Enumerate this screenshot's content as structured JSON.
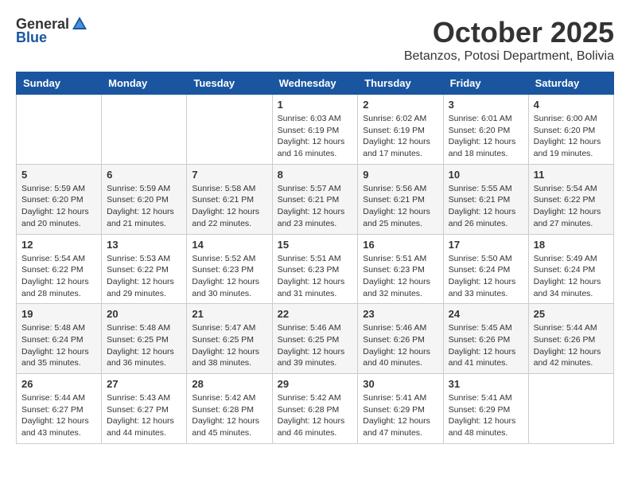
{
  "header": {
    "logo_general": "General",
    "logo_blue": "Blue",
    "month_title": "October 2025",
    "location": "Betanzos, Potosi Department, Bolivia"
  },
  "days_of_week": [
    "Sunday",
    "Monday",
    "Tuesday",
    "Wednesday",
    "Thursday",
    "Friday",
    "Saturday"
  ],
  "weeks": [
    [
      {
        "day": "",
        "sunrise": "",
        "sunset": "",
        "daylight": ""
      },
      {
        "day": "",
        "sunrise": "",
        "sunset": "",
        "daylight": ""
      },
      {
        "day": "",
        "sunrise": "",
        "sunset": "",
        "daylight": ""
      },
      {
        "day": "1",
        "sunrise": "Sunrise: 6:03 AM",
        "sunset": "Sunset: 6:19 PM",
        "daylight": "Daylight: 12 hours and 16 minutes."
      },
      {
        "day": "2",
        "sunrise": "Sunrise: 6:02 AM",
        "sunset": "Sunset: 6:19 PM",
        "daylight": "Daylight: 12 hours and 17 minutes."
      },
      {
        "day": "3",
        "sunrise": "Sunrise: 6:01 AM",
        "sunset": "Sunset: 6:20 PM",
        "daylight": "Daylight: 12 hours and 18 minutes."
      },
      {
        "day": "4",
        "sunrise": "Sunrise: 6:00 AM",
        "sunset": "Sunset: 6:20 PM",
        "daylight": "Daylight: 12 hours and 19 minutes."
      }
    ],
    [
      {
        "day": "5",
        "sunrise": "Sunrise: 5:59 AM",
        "sunset": "Sunset: 6:20 PM",
        "daylight": "Daylight: 12 hours and 20 minutes."
      },
      {
        "day": "6",
        "sunrise": "Sunrise: 5:59 AM",
        "sunset": "Sunset: 6:20 PM",
        "daylight": "Daylight: 12 hours and 21 minutes."
      },
      {
        "day": "7",
        "sunrise": "Sunrise: 5:58 AM",
        "sunset": "Sunset: 6:21 PM",
        "daylight": "Daylight: 12 hours and 22 minutes."
      },
      {
        "day": "8",
        "sunrise": "Sunrise: 5:57 AM",
        "sunset": "Sunset: 6:21 PM",
        "daylight": "Daylight: 12 hours and 23 minutes."
      },
      {
        "day": "9",
        "sunrise": "Sunrise: 5:56 AM",
        "sunset": "Sunset: 6:21 PM",
        "daylight": "Daylight: 12 hours and 25 minutes."
      },
      {
        "day": "10",
        "sunrise": "Sunrise: 5:55 AM",
        "sunset": "Sunset: 6:21 PM",
        "daylight": "Daylight: 12 hours and 26 minutes."
      },
      {
        "day": "11",
        "sunrise": "Sunrise: 5:54 AM",
        "sunset": "Sunset: 6:22 PM",
        "daylight": "Daylight: 12 hours and 27 minutes."
      }
    ],
    [
      {
        "day": "12",
        "sunrise": "Sunrise: 5:54 AM",
        "sunset": "Sunset: 6:22 PM",
        "daylight": "Daylight: 12 hours and 28 minutes."
      },
      {
        "day": "13",
        "sunrise": "Sunrise: 5:53 AM",
        "sunset": "Sunset: 6:22 PM",
        "daylight": "Daylight: 12 hours and 29 minutes."
      },
      {
        "day": "14",
        "sunrise": "Sunrise: 5:52 AM",
        "sunset": "Sunset: 6:23 PM",
        "daylight": "Daylight: 12 hours and 30 minutes."
      },
      {
        "day": "15",
        "sunrise": "Sunrise: 5:51 AM",
        "sunset": "Sunset: 6:23 PM",
        "daylight": "Daylight: 12 hours and 31 minutes."
      },
      {
        "day": "16",
        "sunrise": "Sunrise: 5:51 AM",
        "sunset": "Sunset: 6:23 PM",
        "daylight": "Daylight: 12 hours and 32 minutes."
      },
      {
        "day": "17",
        "sunrise": "Sunrise: 5:50 AM",
        "sunset": "Sunset: 6:24 PM",
        "daylight": "Daylight: 12 hours and 33 minutes."
      },
      {
        "day": "18",
        "sunrise": "Sunrise: 5:49 AM",
        "sunset": "Sunset: 6:24 PM",
        "daylight": "Daylight: 12 hours and 34 minutes."
      }
    ],
    [
      {
        "day": "19",
        "sunrise": "Sunrise: 5:48 AM",
        "sunset": "Sunset: 6:24 PM",
        "daylight": "Daylight: 12 hours and 35 minutes."
      },
      {
        "day": "20",
        "sunrise": "Sunrise: 5:48 AM",
        "sunset": "Sunset: 6:25 PM",
        "daylight": "Daylight: 12 hours and 36 minutes."
      },
      {
        "day": "21",
        "sunrise": "Sunrise: 5:47 AM",
        "sunset": "Sunset: 6:25 PM",
        "daylight": "Daylight: 12 hours and 38 minutes."
      },
      {
        "day": "22",
        "sunrise": "Sunrise: 5:46 AM",
        "sunset": "Sunset: 6:25 PM",
        "daylight": "Daylight: 12 hours and 39 minutes."
      },
      {
        "day": "23",
        "sunrise": "Sunrise: 5:46 AM",
        "sunset": "Sunset: 6:26 PM",
        "daylight": "Daylight: 12 hours and 40 minutes."
      },
      {
        "day": "24",
        "sunrise": "Sunrise: 5:45 AM",
        "sunset": "Sunset: 6:26 PM",
        "daylight": "Daylight: 12 hours and 41 minutes."
      },
      {
        "day": "25",
        "sunrise": "Sunrise: 5:44 AM",
        "sunset": "Sunset: 6:26 PM",
        "daylight": "Daylight: 12 hours and 42 minutes."
      }
    ],
    [
      {
        "day": "26",
        "sunrise": "Sunrise: 5:44 AM",
        "sunset": "Sunset: 6:27 PM",
        "daylight": "Daylight: 12 hours and 43 minutes."
      },
      {
        "day": "27",
        "sunrise": "Sunrise: 5:43 AM",
        "sunset": "Sunset: 6:27 PM",
        "daylight": "Daylight: 12 hours and 44 minutes."
      },
      {
        "day": "28",
        "sunrise": "Sunrise: 5:42 AM",
        "sunset": "Sunset: 6:28 PM",
        "daylight": "Daylight: 12 hours and 45 minutes."
      },
      {
        "day": "29",
        "sunrise": "Sunrise: 5:42 AM",
        "sunset": "Sunset: 6:28 PM",
        "daylight": "Daylight: 12 hours and 46 minutes."
      },
      {
        "day": "30",
        "sunrise": "Sunrise: 5:41 AM",
        "sunset": "Sunset: 6:29 PM",
        "daylight": "Daylight: 12 hours and 47 minutes."
      },
      {
        "day": "31",
        "sunrise": "Sunrise: 5:41 AM",
        "sunset": "Sunset: 6:29 PM",
        "daylight": "Daylight: 12 hours and 48 minutes."
      },
      {
        "day": "",
        "sunrise": "",
        "sunset": "",
        "daylight": ""
      }
    ]
  ]
}
